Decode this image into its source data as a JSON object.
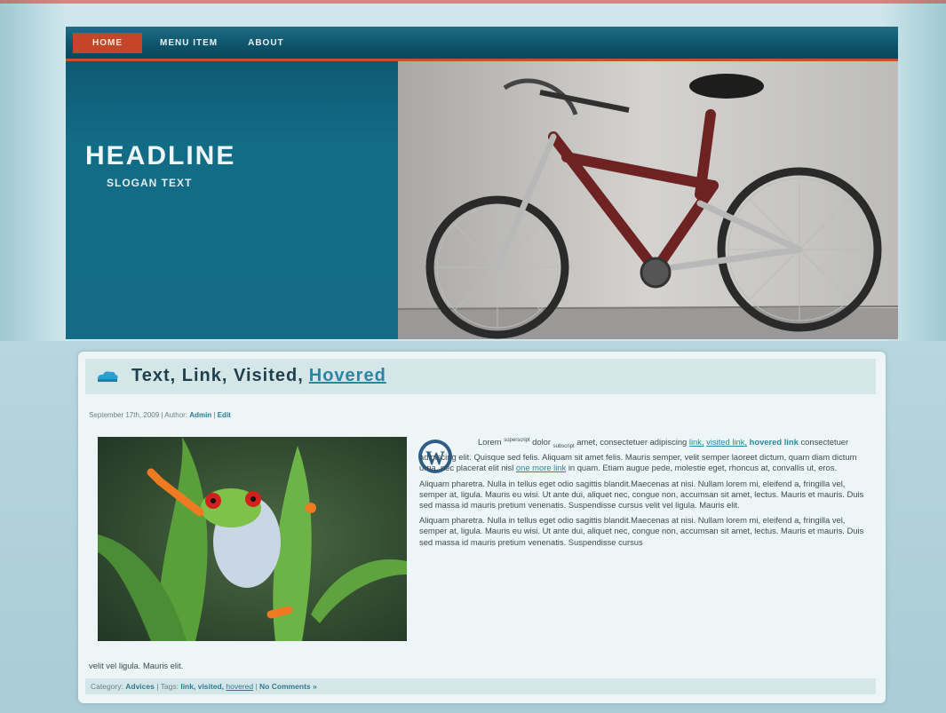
{
  "nav": {
    "items": [
      {
        "label": "HOME",
        "active": true
      },
      {
        "label": "MENU ITEM",
        "active": false
      },
      {
        "label": "ABOUT",
        "active": false
      }
    ]
  },
  "header": {
    "headline": "HEADLINE",
    "slogan": "SLOGAN TEXT"
  },
  "post": {
    "title_prefix": "Text, Link, Visited,",
    "title_link": "Hovered",
    "meta": {
      "date": "September 17th, 2009",
      "author_label": "Author:",
      "author": "Admin",
      "edit": "Edit"
    },
    "para1": {
      "lorem": "Lorem",
      "sup": "superscript",
      "dolor": "dolor",
      "sub": "subscript",
      "rest1": "amet, consectetuer adipiscing",
      "link": "link,",
      "visited": "visited link,",
      "hovered": "hovered link",
      "rest2": "consectetuer adipiscing elit. Quisque sed felis. Aliquam sit amet felis. Mauris semper, velit semper laoreet dictum, quam diam dictum urna, nec placerat elit nisl",
      "inline_link": "one more link",
      "rest3": "in quam. Etiam augue pede, molestie eget, rhoncus at, convallis ut, eros."
    },
    "para2": "Aliquam pharetra. Nulla in tellus eget odio sagittis blandit.Maecenas at nisi. Nullam lorem mi, eleifend a, fringilla vel, semper at, ligula. Mauris eu wisi. Ut ante dui, aliquet nec, congue non, accumsan sit amet, lectus. Mauris et mauris. Duis sed massa id mauris pretium venenatis. Suspendisse cursus velit vel ligula. Mauris elit.",
    "para3": "Aliquam pharetra. Nulla in tellus eget odio sagittis blandit.Maecenas at nisi. Nullam lorem mi, eleifend a, fringilla vel, semper at, ligula. Mauris eu wisi. Ut ante dui, aliquet nec, congue non, accumsan sit amet, lectus. Mauris et mauris. Duis sed massa id mauris pretium venenatis. Suspendisse cursus",
    "tail": "velit vel ligula. Mauris elit.",
    "footer": {
      "category_label": "Category:",
      "category": "Advices",
      "tags_label": "Tags:",
      "tags": [
        "link,",
        "visited,"
      ],
      "hovered_tag": "hovered",
      "comments": "No Comments »"
    }
  },
  "colors": {
    "accent": "#c4452a",
    "header": "#136c86",
    "link": "#2b88a5"
  }
}
